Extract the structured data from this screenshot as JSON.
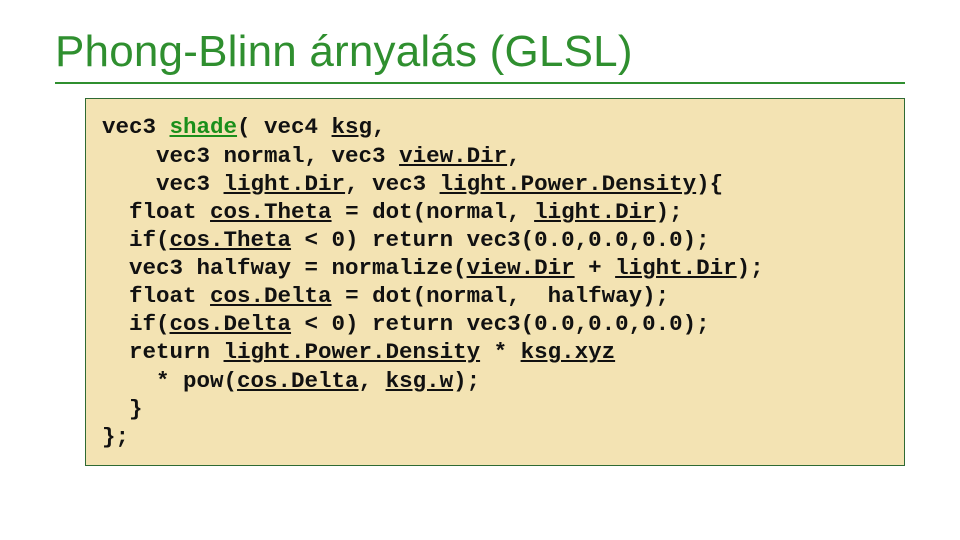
{
  "title": "Phong-Blinn árnyalás (GLSL)",
  "code": {
    "l1a": "vec3 ",
    "l1fn": "shade",
    "l1b": "( vec4 ",
    "l1c": "ksg",
    "l1d": ",",
    "l2a": "    vec3 normal, vec3 ",
    "l2b": "view.Dir",
    "l2c": ",",
    "l3a": "    vec3 ",
    "l3b": "light.Dir",
    "l3c": ", vec3 ",
    "l3d": "light.Power.Density",
    "l3e": "){",
    "l4a": "  float ",
    "l4b": "cos.Theta",
    "l4c": " = dot(normal, ",
    "l4d": "light.Dir",
    "l4e": ");",
    "l5a": "  if(",
    "l5b": "cos.Theta",
    "l5c": " < 0) return vec3(0.0,0.0,0.0);",
    "l6a": "  vec3 halfway = normalize(",
    "l6b": "view.Dir",
    "l6c": " + ",
    "l6d": "light.Dir",
    "l6e": ");",
    "l7a": "  float ",
    "l7b": "cos.Delta",
    "l7c": " = dot(normal,  halfway);",
    "l8a": "  if(",
    "l8b": "cos.Delta",
    "l8c": " < 0) return vec3(0.0,0.0,0.0);",
    "l9a": "  return ",
    "l9b": "light.Power.Density",
    "l9c": " * ",
    "l9d": "ksg.xyz",
    "l10a": "    * pow(",
    "l10b": "cos.Delta",
    "l10c": ", ",
    "l10d": "ksg.w",
    "l10e": ");",
    "l11": "  }",
    "l12": "};"
  }
}
